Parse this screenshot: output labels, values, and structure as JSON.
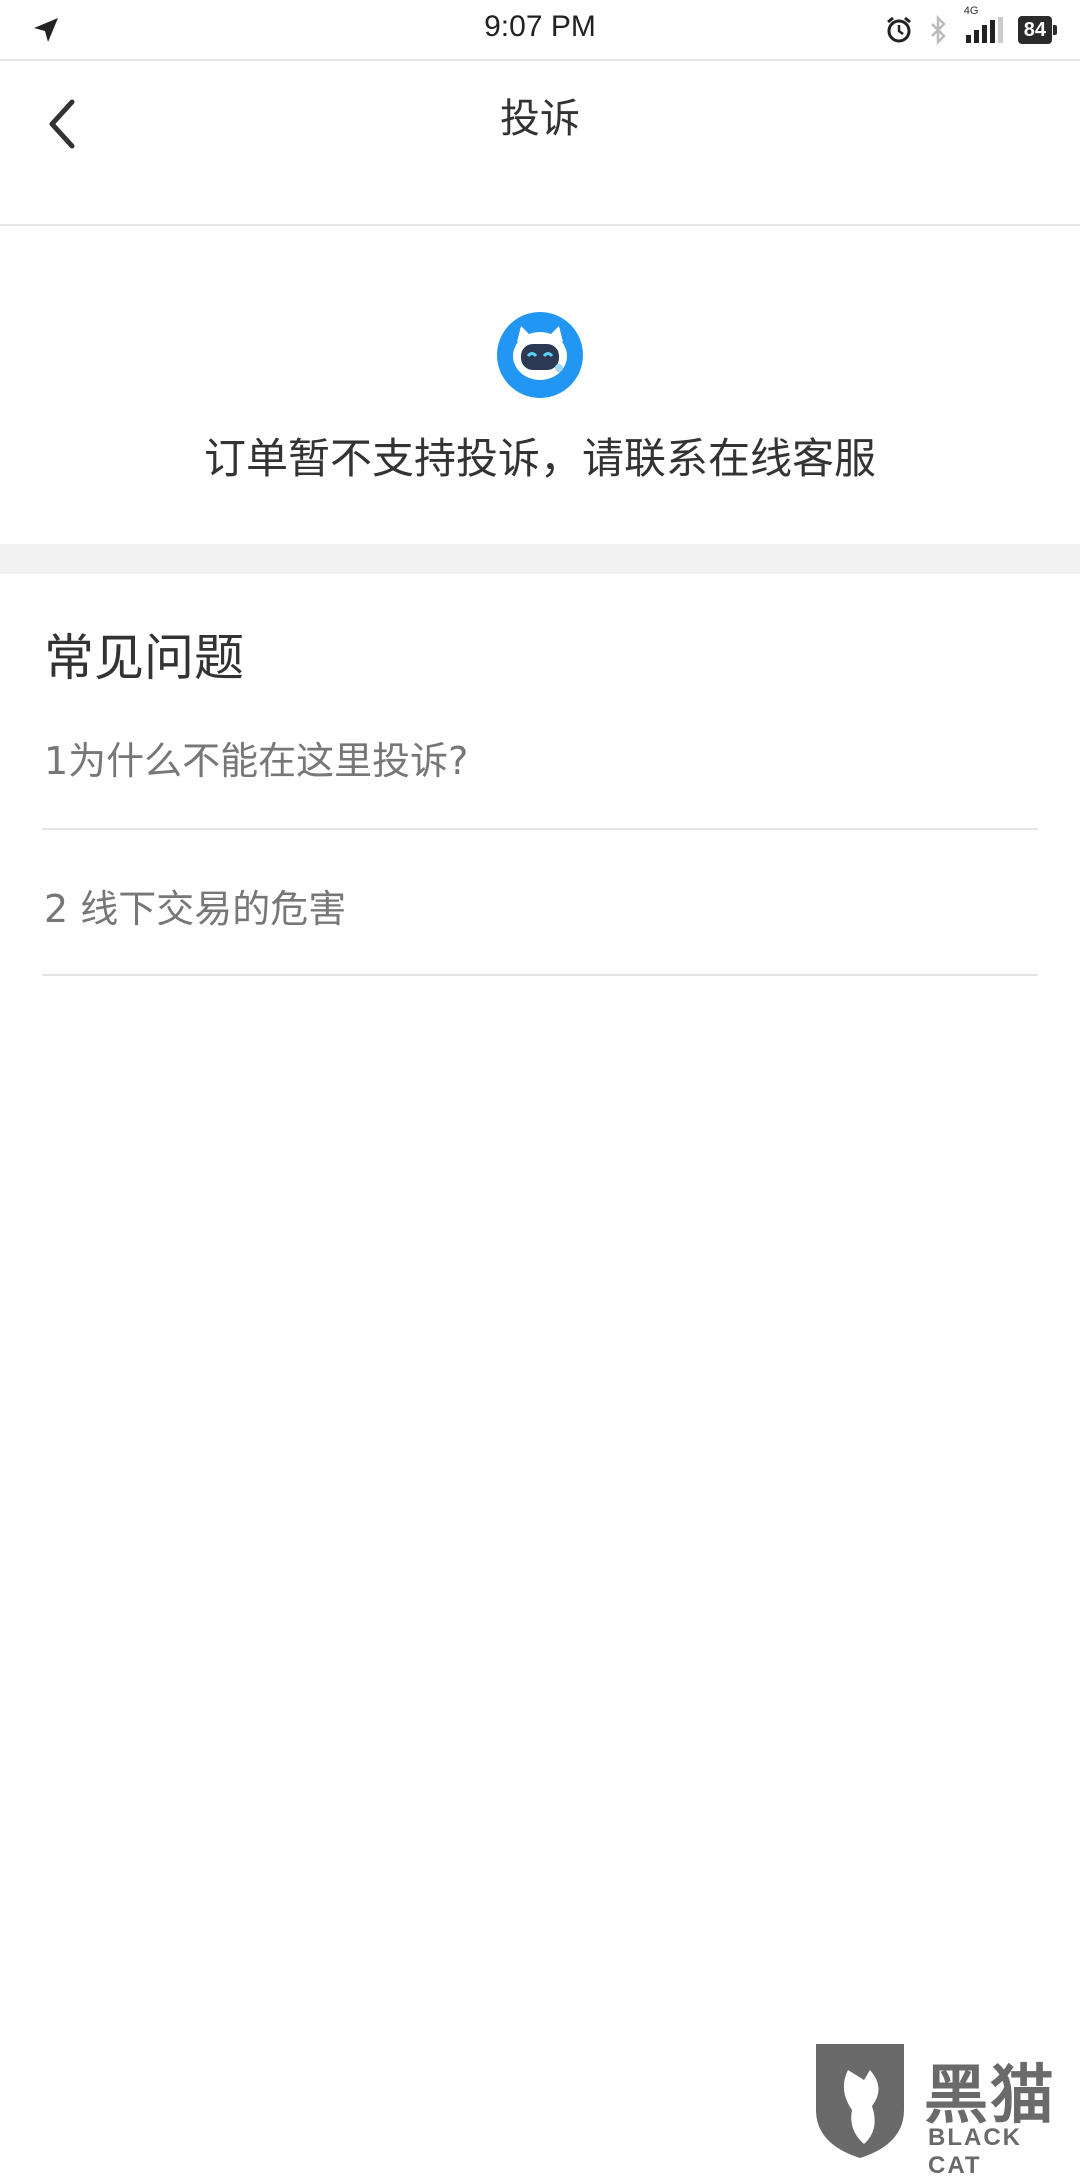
{
  "status_bar": {
    "time": "9:07 PM",
    "network": "4G",
    "battery": "84",
    "icons": [
      "location-arrow-icon",
      "alarm-clock-icon",
      "bluetooth-icon",
      "signal-icon",
      "battery-icon"
    ]
  },
  "nav": {
    "title": "投诉",
    "back_icon": "chevron-left-icon"
  },
  "notice": {
    "avatar_icon": "service-bot-icon",
    "message": "订单暂不支持投诉，请联系在线客服"
  },
  "faq": {
    "title": "常见问题",
    "items": [
      {
        "label": "1为什么不能在这里投诉?"
      },
      {
        "label": "2 线下交易的危害"
      }
    ]
  },
  "watermark": {
    "cn": "黑猫",
    "en": "BLACK CAT"
  },
  "colors": {
    "accent": "#2196f3",
    "text_primary": "#333333",
    "text_secondary": "#777777",
    "divider": "#e4e4e4",
    "band": "#f2f2f2"
  }
}
